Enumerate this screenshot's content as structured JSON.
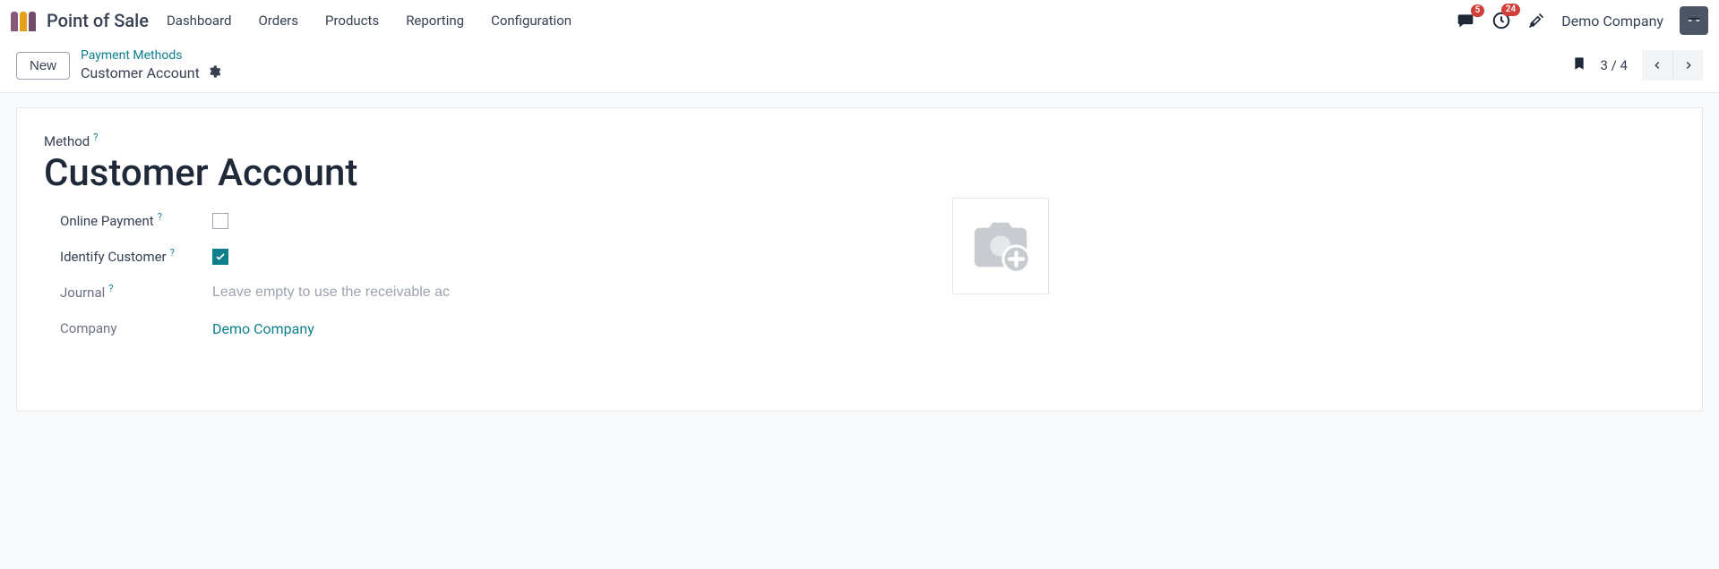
{
  "navbar": {
    "app_title": "Point of Sale",
    "menu": [
      "Dashboard",
      "Orders",
      "Products",
      "Reporting",
      "Configuration"
    ],
    "messages_badge": "5",
    "activities_badge": "24",
    "company": "Demo Company"
  },
  "controlbar": {
    "new_label": "New",
    "breadcrumb_parent": "Payment Methods",
    "breadcrumb_current": "Customer Account",
    "pager_text": "3 / 4"
  },
  "form": {
    "method_label": "Method",
    "method_value": "Customer Account",
    "online_payment_label": "Online Payment",
    "identify_customer_label": "Identify Customer",
    "journal_label": "Journal",
    "journal_placeholder": "Leave empty to use the receivable ac",
    "company_label": "Company",
    "company_value": "Demo Company",
    "help_q": "?"
  }
}
